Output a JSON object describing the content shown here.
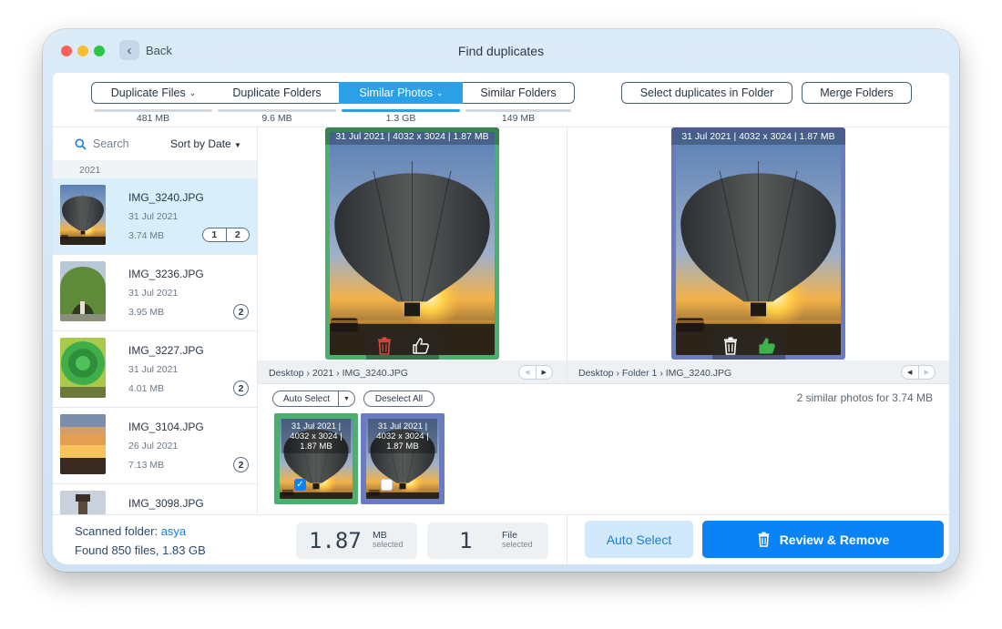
{
  "window": {
    "title": "Find duplicates",
    "back_label": "Back"
  },
  "tabs": [
    {
      "label": "Duplicate Files",
      "chevron": true,
      "size": "481 MB",
      "active": false
    },
    {
      "label": "Duplicate Folders",
      "chevron": false,
      "size": "9.6 MB",
      "active": false
    },
    {
      "label": "Similar Photos",
      "chevron": true,
      "size": "1.3 GB",
      "active": true
    },
    {
      "label": "Similar Folders",
      "chevron": false,
      "size": "149 MB",
      "active": false
    }
  ],
  "toolbar": {
    "select_in_folder": "Select duplicates in Folder",
    "merge_folders": "Merge Folders"
  },
  "sidebar": {
    "search_placeholder": "Search",
    "sort_label": "Sort by Date",
    "year": "2021",
    "items": [
      {
        "name": "IMG_3240.JPG",
        "date": "31 Jul 2021",
        "size": "3.74 MB",
        "badges": [
          "1",
          "2"
        ]
      },
      {
        "name": "IMG_3236.JPG",
        "date": "31 Jul 2021",
        "size": "3.95 MB",
        "badges": [
          "2"
        ]
      },
      {
        "name": "IMG_3227.JPG",
        "date": "31 Jul 2021",
        "size": "4.01 MB",
        "badges": [
          "2"
        ]
      },
      {
        "name": "IMG_3104.JPG",
        "date": "26 Jul 2021",
        "size": "7.13 MB",
        "badges": [
          "2"
        ]
      },
      {
        "name": "IMG_3098.JPG",
        "date": "",
        "size": "",
        "badges": []
      }
    ]
  },
  "preview": {
    "left": {
      "caption": "31 Jul 2021 | 4032 x 3024 | 1.87 MB",
      "path": [
        "Desktop",
        "2021",
        "IMG_3240.JPG"
      ],
      "frame_color": "#4caf6e"
    },
    "right": {
      "caption": "31 Jul 2021 | 4032 x 3024 | 1.87 MB",
      "path": [
        "Desktop",
        "Folder 1",
        "IMG_3240.JPG"
      ],
      "frame_color": "#6a7bc2"
    }
  },
  "group": {
    "auto_select": "Auto Select",
    "deselect_all": "Deselect All",
    "summary": "2 similar photos for 3.74 MB",
    "thumbs": [
      {
        "caption_lines": [
          "31 Jul 2021 |",
          "4032 x 3024 |",
          "1.87 MB"
        ],
        "checked": true
      },
      {
        "caption_lines": [
          "31 Jul 2021 |",
          "4032 x 3024 |",
          "1.87 MB"
        ],
        "checked": false
      }
    ]
  },
  "footer": {
    "scanned_label": "Scanned folder:",
    "scanned_folder": "asya",
    "found_text": "Found 850 files, 1.83 GB",
    "size_value": "1.87",
    "size_unit": "MB",
    "size_sub": "selected",
    "count_value": "1",
    "count_unit": "File",
    "count_sub": "selected",
    "auto_select": "Auto Select",
    "review_remove": "Review & Remove"
  },
  "colors": {
    "accent": "#0a84f5",
    "active_tab": "#2aa0e6",
    "keep_frame": "#4caf6e",
    "other_frame": "#6a7bc2",
    "trash_red": "#e0463c",
    "thumb_green": "#3fb24a"
  }
}
